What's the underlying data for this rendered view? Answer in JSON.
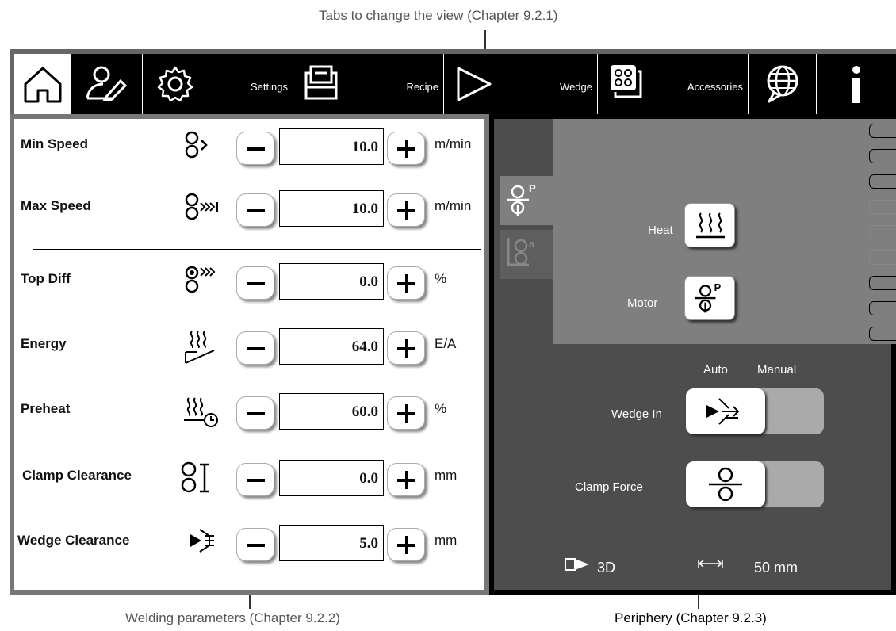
{
  "callouts": {
    "top": "Tabs to change the view (Chapter 9.2.1)",
    "bottom_left": "Welding parameters (Chapter 9.2.2)",
    "bottom_right": "Periphery (Chapter 9.2.3)"
  },
  "tabs": {
    "home_icon": "home-icon",
    "user_icon": "user-edit-icon",
    "settings_label": "Settings",
    "recipe_label": "Recipe",
    "wedge_label": "Wedge",
    "accessories_label": "Accessories",
    "language_icon": "globe-icon",
    "info_icon": "info-icon"
  },
  "parameters": [
    {
      "label": "Min Speed",
      "icon": "min-speed-icon",
      "value": "10.0",
      "unit": "m/min"
    },
    {
      "label": "Max Speed",
      "icon": "max-speed-icon",
      "value": "10.0",
      "unit": "m/min"
    },
    {
      "label": "Top Diff",
      "icon": "top-diff-icon",
      "value": "0.0",
      "unit": "%"
    },
    {
      "label": "Energy",
      "icon": "energy-icon",
      "value": "64.0",
      "unit": "E/A"
    },
    {
      "label": "Preheat",
      "icon": "preheat-icon",
      "value": "60.0",
      "unit": "%"
    },
    {
      "label": "Clamp Clearance",
      "icon": "clamp-clearance-icon",
      "value": "0.0",
      "unit": "mm"
    },
    {
      "label": "Wedge Clearance",
      "icon": "wedge-clearance-icon",
      "value": "5.0",
      "unit": "mm"
    }
  ],
  "periphery": {
    "heat_label": "Heat",
    "motor_label": "Motor",
    "auto_label": "Auto",
    "manual_label": "Manual",
    "wedge_in_label": "Wedge In",
    "clamp_force_label": "Clamp Force",
    "mode_value": "3D",
    "width_value": "50 mm",
    "wedge_in_state": "Auto",
    "clamp_force_state": "Auto"
  },
  "colors": {
    "tab_bar": "#000000",
    "periphery_bg": "#4d4d4d",
    "periphery_top": "#7f7f7f"
  }
}
